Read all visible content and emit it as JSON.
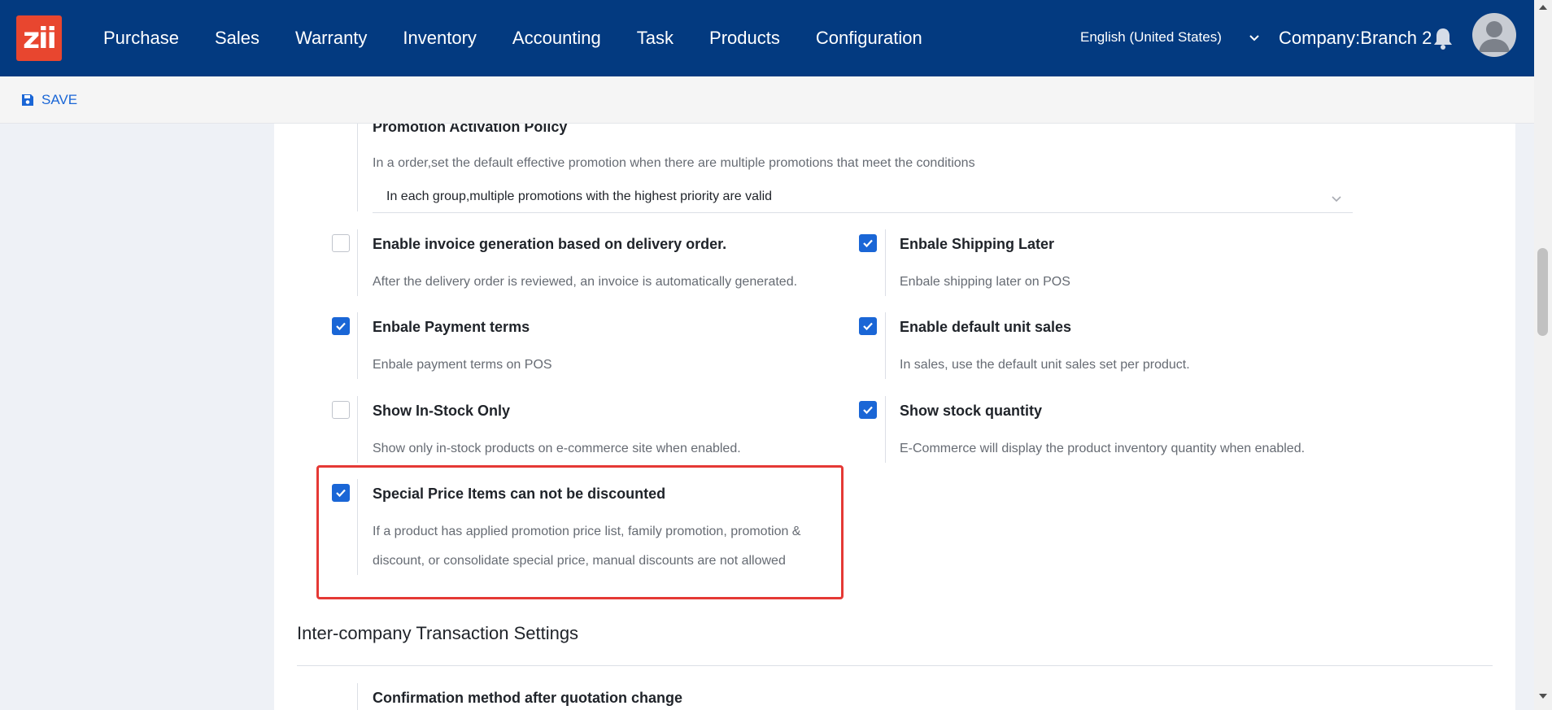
{
  "navbar": {
    "logo_text": "zii",
    "menu": [
      "Purchase",
      "Sales",
      "Warranty",
      "Inventory",
      "Accounting",
      "Task",
      "Products",
      "Configuration"
    ],
    "language": "English (United States)",
    "company": "Company:Branch 2"
  },
  "toolbar": {
    "save_label": "SAVE"
  },
  "promotion_policy": {
    "title": "Promotion Activation Policy",
    "description": "In a order,set the default effective promotion when there are multiple promotions that meet the conditions",
    "selected": "In each group,multiple promotions with the highest priority are valid"
  },
  "settings": [
    {
      "title": "Enable invoice generation based on delivery order.",
      "description": "After the delivery order is reviewed, an invoice is automatically generated.",
      "checked": false
    },
    {
      "title": "Enbale Shipping Later",
      "description": "Enbale shipping later on POS",
      "checked": true
    },
    {
      "title": "Enbale Payment terms",
      "description": "Enbale payment terms on POS",
      "checked": true
    },
    {
      "title": "Enable default unit sales",
      "description": "In sales, use the default unit sales set per product.",
      "checked": true
    },
    {
      "title": "Show In-Stock Only",
      "description": "Show only in-stock products on e-commerce site when enabled.",
      "checked": false
    },
    {
      "title": "Show stock quantity",
      "description": "E-Commerce will display the product inventory quantity when enabled.",
      "checked": true
    },
    {
      "title": "Special Price Items can not be discounted",
      "description_line1": "If a product has applied promotion price list, family promotion, promotion &",
      "description_line2": "discount, or consolidate special price, manual discounts are not allowed",
      "checked": true
    }
  ],
  "intercompany": {
    "heading": "Inter-company Transaction Settings",
    "first_item_title": "Confirmation method after quotation change"
  },
  "colors": {
    "navbar": "#033a80",
    "accent": "#1a66d6",
    "highlight": "#e53935",
    "logo": "#e8462f"
  },
  "icons": [
    "save-icon",
    "chevron-down-icon",
    "bell-icon",
    "user-avatar-icon",
    "check-icon"
  ]
}
